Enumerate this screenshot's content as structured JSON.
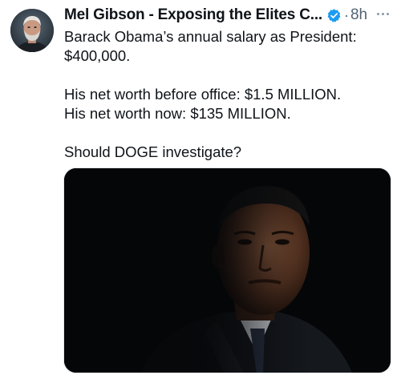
{
  "tweet": {
    "author": {
      "name": "Mel Gibson - Exposing the Elites C...",
      "verified": true,
      "avatar_icon": "profile-photo"
    },
    "separator": "·",
    "time": "8h",
    "more_icon": "more-horizontal-icon",
    "lines": [
      "Barack Obama’s annual salary as President:",
      "$400,000.",
      "His net worth before office: $1.5 MILLION.",
      "His net worth now: $135 MILLION.",
      "Should DOGE investigate?"
    ],
    "colors": {
      "text": "#0f1419",
      "secondary": "#536471",
      "verified_badge": "#1d9bf0"
    }
  }
}
